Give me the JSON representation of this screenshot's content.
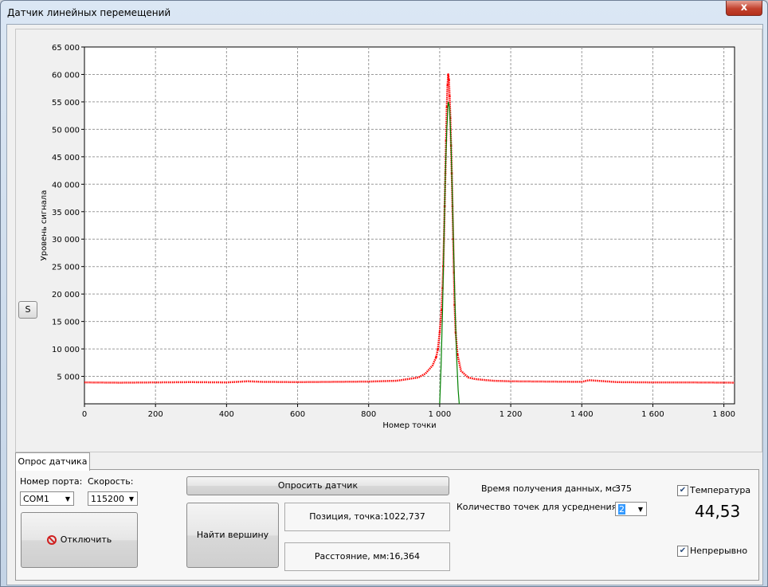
{
  "window": {
    "title": "Датчик линейных перемещений",
    "close_glyph": "x"
  },
  "side_button": {
    "label": "S"
  },
  "chart_data": {
    "type": "scatter",
    "title": "",
    "xlabel": "Номер точки",
    "ylabel": "Уровень сигнала",
    "xlim": [
      0,
      1830
    ],
    "ylim": [
      0,
      65000
    ],
    "xticks": [
      0,
      200,
      400,
      600,
      800,
      1000,
      1200,
      1400,
      1600,
      1800
    ],
    "xtick_labels": [
      "0",
      "200",
      "400",
      "600",
      "800",
      "1 000",
      "1 200",
      "1 400",
      "1 600",
      "1 800"
    ],
    "yticks": [
      5000,
      10000,
      15000,
      20000,
      25000,
      30000,
      35000,
      40000,
      45000,
      50000,
      55000,
      60000,
      65000
    ],
    "ytick_labels": [
      "5 000",
      "10 000",
      "15 000",
      "20 000",
      "25 000",
      "30 000",
      "35 000",
      "40 000",
      "45 000",
      "50 000",
      "55 000",
      "60 000",
      "65 000"
    ],
    "grid": true,
    "series": [
      {
        "color": "#ff0000",
        "x": [
          0,
          100,
          200,
          300,
          400,
          460,
          500,
          600,
          700,
          800,
          880,
          940,
          960,
          980,
          990,
          995,
          1000,
          1005,
          1008,
          1010,
          1012,
          1014,
          1016,
          1018,
          1020,
          1022,
          1024,
          1026,
          1028,
          1030,
          1032,
          1034,
          1036,
          1038,
          1040,
          1042,
          1045,
          1050,
          1060,
          1080,
          1100,
          1150,
          1200,
          1300,
          1400,
          1420,
          1500,
          1600,
          1700,
          1830
        ],
        "y": [
          3900,
          3850,
          3900,
          3950,
          3900,
          4100,
          4000,
          3950,
          4000,
          4050,
          4200,
          4800,
          5500,
          7000,
          8500,
          10000,
          13000,
          17000,
          21000,
          25000,
          30000,
          36000,
          42000,
          48000,
          54000,
          58000,
          60000,
          59000,
          56000,
          52000,
          47000,
          42000,
          36000,
          30000,
          24000,
          18000,
          13000,
          9000,
          6000,
          4800,
          4500,
          4200,
          4100,
          4050,
          4000,
          4300,
          3950,
          3900,
          3900,
          3850
        ]
      },
      {
        "color": "#008000",
        "x": [
          1000,
          1004,
          1008,
          1012,
          1016,
          1020,
          1024,
          1028,
          1032,
          1036,
          1040,
          1044,
          1048,
          1052,
          1055
        ],
        "y": [
          0,
          7000,
          17000,
          30000,
          42000,
          50000,
          55000,
          54000,
          47000,
          37000,
          26000,
          16000,
          8000,
          2500,
          0
        ]
      }
    ]
  },
  "tab": {
    "label": "Опрос датчика"
  },
  "port": {
    "label": "Номер порта:",
    "value": "COM1"
  },
  "speed": {
    "label": "Скорость:",
    "value": "115200"
  },
  "disconnect_button": {
    "label": "Отключить",
    "icon": "stop-icon"
  },
  "poll_button": {
    "label": "Опросить датчик"
  },
  "find_peak_button": {
    "label": "Найти вершину"
  },
  "position": {
    "label": "Позиция, точка:",
    "value": "1022,737"
  },
  "distance": {
    "label": "Расстояние, мм:",
    "value": "16,364"
  },
  "acq_time": {
    "label": "Время получения данных, мс:",
    "value": "375"
  },
  "avg_points": {
    "label": "Количество точек для усреднения:",
    "value": "2"
  },
  "temperature": {
    "label": "Температура",
    "checked": true,
    "value": "44,53"
  },
  "continuous": {
    "label": "Непрерывно",
    "checked": true
  }
}
